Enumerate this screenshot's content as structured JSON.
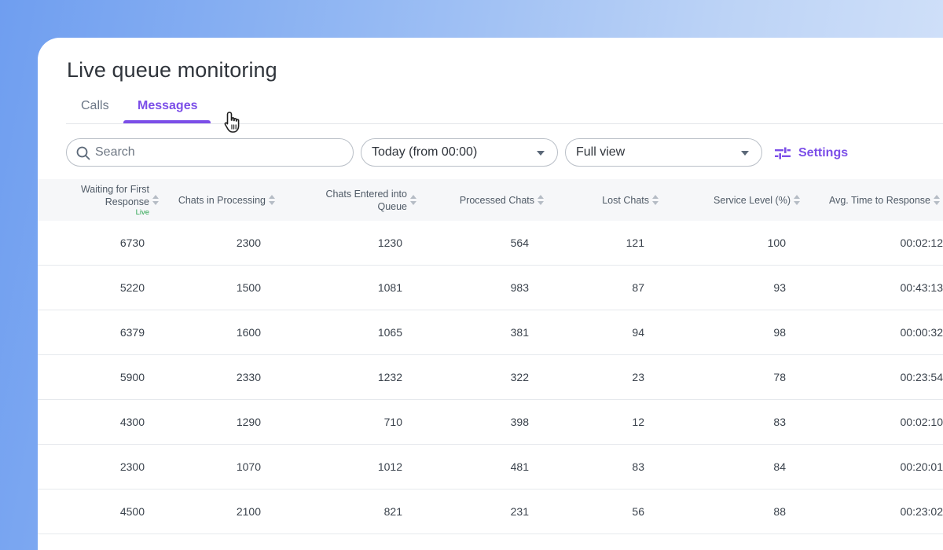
{
  "page": {
    "title": "Live queue monitoring"
  },
  "tabs": [
    {
      "label": "Calls",
      "active": false
    },
    {
      "label": "Messages",
      "active": true
    }
  ],
  "toolbar": {
    "search_placeholder": "Search",
    "date_filter": "Today (from 00:00)",
    "view_filter": "Full view",
    "settings_label": "Settings"
  },
  "table": {
    "columns": [
      {
        "label": "Waiting for First Response",
        "badge": "Live"
      },
      {
        "label": "Chats in Processing"
      },
      {
        "label": "Chats Entered into Queue"
      },
      {
        "label": "Processed Chats"
      },
      {
        "label": "Lost Chats"
      },
      {
        "label": "Service Level (%)"
      },
      {
        "label": "Avg. Time to Response"
      }
    ],
    "rows": [
      [
        "6730",
        "2300",
        "1230",
        "564",
        "121",
        "100",
        "00:02:12"
      ],
      [
        "5220",
        "1500",
        "1081",
        "983",
        "87",
        "93",
        "00:43:13"
      ],
      [
        "6379",
        "1600",
        "1065",
        "381",
        "94",
        "98",
        "00:00:32"
      ],
      [
        "5900",
        "2330",
        "1232",
        "322",
        "23",
        "78",
        "00:23:54"
      ],
      [
        "4300",
        "1290",
        "710",
        "398",
        "12",
        "83",
        "00:02:10"
      ],
      [
        "2300",
        "1070",
        "1012",
        "481",
        "83",
        "84",
        "00:20:01"
      ],
      [
        "4500",
        "2100",
        "821",
        "231",
        "56",
        "88",
        "00:23:02"
      ]
    ]
  },
  "colors": {
    "accent": "#7b4ee8",
    "live": "#2aa44f",
    "header_bg": "#f6f7f9"
  }
}
